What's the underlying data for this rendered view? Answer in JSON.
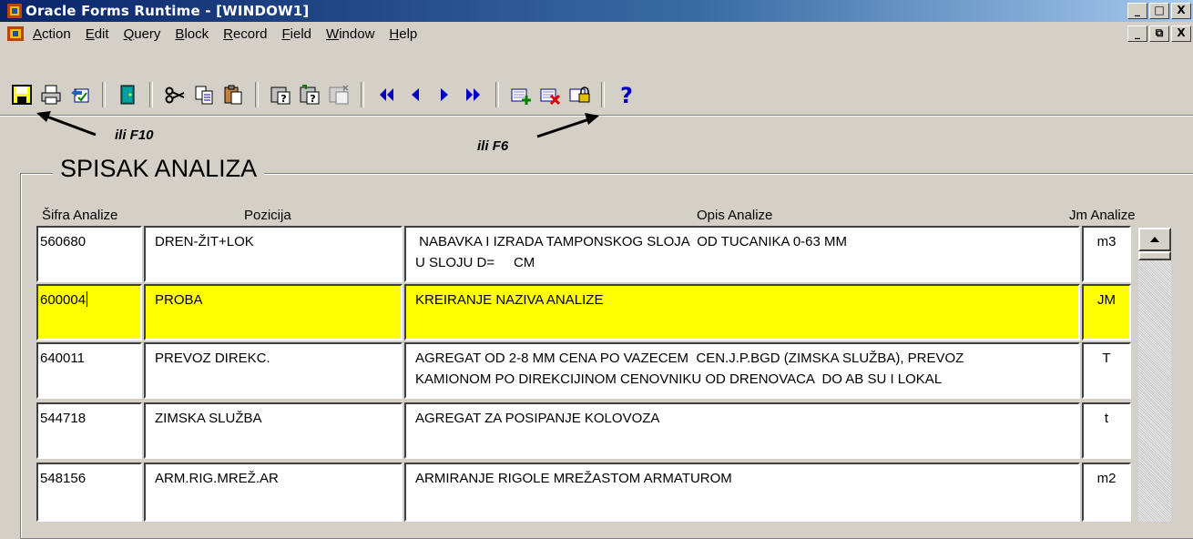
{
  "window": {
    "title": "Oracle Forms Runtime - [WINDOW1]"
  },
  "window_buttons": [
    "_",
    "□",
    "X"
  ],
  "mdi_buttons": [
    "_",
    "⧉",
    "X"
  ],
  "menu": [
    "Action",
    "Edit",
    "Query",
    "Block",
    "Record",
    "Field",
    "Window",
    "Help"
  ],
  "toolbar_icons": [
    "save-icon",
    "print-icon",
    "commit-icon",
    "exit-icon",
    "cut-icon",
    "copy-icon",
    "paste-icon",
    "enter-query-icon",
    "execute-query-icon",
    "cancel-query-icon",
    "first-record-icon",
    "previous-record-icon",
    "next-record-icon",
    "last-record-icon",
    "insert-record-icon",
    "delete-record-icon",
    "lock-record-icon",
    "help-icon"
  ],
  "annotations": {
    "save_hint": "ili F10",
    "insert_hint": "ili F6"
  },
  "frame": {
    "title": "SPISAK ANALIZA"
  },
  "columns": {
    "sifra": "Šifra Analize",
    "pozicija": "Pozicija",
    "opis": "Opis Analize",
    "jm": "Jm Analize"
  },
  "rows": [
    {
      "sifra": "560680",
      "pozicija": "DREN-ŽIT+LOK",
      "opis": [
        " NABAVKA I IZRADA TAMPONSKOG SLOJA  OD TUCANIKA 0-63 MM",
        "U SLOJU D=     CM"
      ],
      "jm": "m3"
    },
    {
      "sifra": "600004",
      "pozicija": "PROBA",
      "opis": [
        "KREIRANJE NAZIVA ANALIZE",
        ""
      ],
      "jm": "JM"
    },
    {
      "sifra": "640011",
      "pozicija": "PREVOZ DIREKC.",
      "opis": [
        "AGREGAT OD 2-8 MM CENA PO VAZECEM  CEN.J.P.BGD (ZIMSKA SLUŽBA), PREVOZ",
        "KAMIONOM PO DIREKCIJINOM CENOVNIKU OD DRENOVACA  DO AB SU I LOKAL"
      ],
      "jm": "T"
    },
    {
      "sifra": "544718",
      "pozicija": "ZIMSKA SLUŽBA",
      "opis": [
        "AGREGAT ZA POSIPANJE KOLOVOZA",
        ""
      ],
      "jm": "t"
    },
    {
      "sifra": "548156",
      "pozicija": "ARM.RIG.MREŽ.AR",
      "opis": [
        "ARMIRANJE RIGOLE MREŽASTOM ARMATUROM",
        ""
      ],
      "jm": "m2"
    }
  ],
  "colors": {
    "highlight": "#ffff00",
    "title_bar": "#0a246a",
    "background": "#d4d0c8"
  }
}
